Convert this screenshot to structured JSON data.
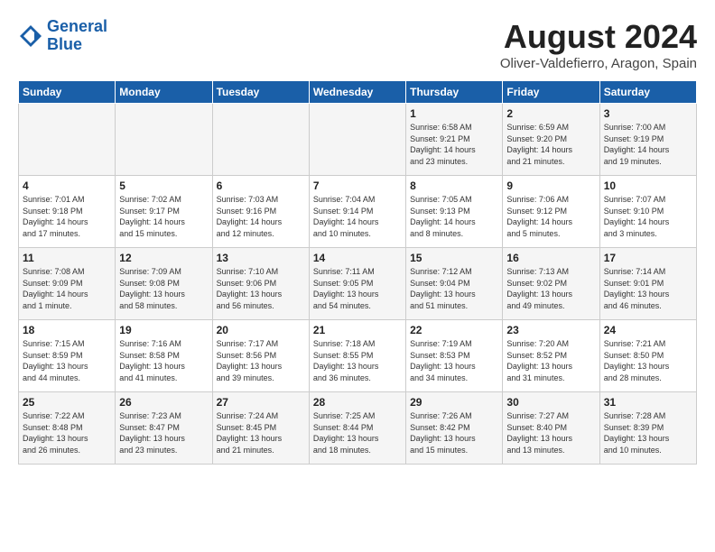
{
  "header": {
    "logo_line1": "General",
    "logo_line2": "Blue",
    "title": "August 2024",
    "subtitle": "Oliver-Valdefierro, Aragon, Spain"
  },
  "weekdays": [
    "Sunday",
    "Monday",
    "Tuesday",
    "Wednesday",
    "Thursday",
    "Friday",
    "Saturday"
  ],
  "weeks": [
    [
      {
        "day": "",
        "empty": true
      },
      {
        "day": "",
        "empty": true
      },
      {
        "day": "",
        "empty": true
      },
      {
        "day": "",
        "empty": true
      },
      {
        "day": "1",
        "lines": [
          "Sunrise: 6:58 AM",
          "Sunset: 9:21 PM",
          "Daylight: 14 hours",
          "and 23 minutes."
        ]
      },
      {
        "day": "2",
        "lines": [
          "Sunrise: 6:59 AM",
          "Sunset: 9:20 PM",
          "Daylight: 14 hours",
          "and 21 minutes."
        ]
      },
      {
        "day": "3",
        "lines": [
          "Sunrise: 7:00 AM",
          "Sunset: 9:19 PM",
          "Daylight: 14 hours",
          "and 19 minutes."
        ]
      }
    ],
    [
      {
        "day": "4",
        "lines": [
          "Sunrise: 7:01 AM",
          "Sunset: 9:18 PM",
          "Daylight: 14 hours",
          "and 17 minutes."
        ]
      },
      {
        "day": "5",
        "lines": [
          "Sunrise: 7:02 AM",
          "Sunset: 9:17 PM",
          "Daylight: 14 hours",
          "and 15 minutes."
        ]
      },
      {
        "day": "6",
        "lines": [
          "Sunrise: 7:03 AM",
          "Sunset: 9:16 PM",
          "Daylight: 14 hours",
          "and 12 minutes."
        ]
      },
      {
        "day": "7",
        "lines": [
          "Sunrise: 7:04 AM",
          "Sunset: 9:14 PM",
          "Daylight: 14 hours",
          "and 10 minutes."
        ]
      },
      {
        "day": "8",
        "lines": [
          "Sunrise: 7:05 AM",
          "Sunset: 9:13 PM",
          "Daylight: 14 hours",
          "and 8 minutes."
        ]
      },
      {
        "day": "9",
        "lines": [
          "Sunrise: 7:06 AM",
          "Sunset: 9:12 PM",
          "Daylight: 14 hours",
          "and 5 minutes."
        ]
      },
      {
        "day": "10",
        "lines": [
          "Sunrise: 7:07 AM",
          "Sunset: 9:10 PM",
          "Daylight: 14 hours",
          "and 3 minutes."
        ]
      }
    ],
    [
      {
        "day": "11",
        "lines": [
          "Sunrise: 7:08 AM",
          "Sunset: 9:09 PM",
          "Daylight: 14 hours",
          "and 1 minute."
        ]
      },
      {
        "day": "12",
        "lines": [
          "Sunrise: 7:09 AM",
          "Sunset: 9:08 PM",
          "Daylight: 13 hours",
          "and 58 minutes."
        ]
      },
      {
        "day": "13",
        "lines": [
          "Sunrise: 7:10 AM",
          "Sunset: 9:06 PM",
          "Daylight: 13 hours",
          "and 56 minutes."
        ]
      },
      {
        "day": "14",
        "lines": [
          "Sunrise: 7:11 AM",
          "Sunset: 9:05 PM",
          "Daylight: 13 hours",
          "and 54 minutes."
        ]
      },
      {
        "day": "15",
        "lines": [
          "Sunrise: 7:12 AM",
          "Sunset: 9:04 PM",
          "Daylight: 13 hours",
          "and 51 minutes."
        ]
      },
      {
        "day": "16",
        "lines": [
          "Sunrise: 7:13 AM",
          "Sunset: 9:02 PM",
          "Daylight: 13 hours",
          "and 49 minutes."
        ]
      },
      {
        "day": "17",
        "lines": [
          "Sunrise: 7:14 AM",
          "Sunset: 9:01 PM",
          "Daylight: 13 hours",
          "and 46 minutes."
        ]
      }
    ],
    [
      {
        "day": "18",
        "lines": [
          "Sunrise: 7:15 AM",
          "Sunset: 8:59 PM",
          "Daylight: 13 hours",
          "and 44 minutes."
        ]
      },
      {
        "day": "19",
        "lines": [
          "Sunrise: 7:16 AM",
          "Sunset: 8:58 PM",
          "Daylight: 13 hours",
          "and 41 minutes."
        ]
      },
      {
        "day": "20",
        "lines": [
          "Sunrise: 7:17 AM",
          "Sunset: 8:56 PM",
          "Daylight: 13 hours",
          "and 39 minutes."
        ]
      },
      {
        "day": "21",
        "lines": [
          "Sunrise: 7:18 AM",
          "Sunset: 8:55 PM",
          "Daylight: 13 hours",
          "and 36 minutes."
        ]
      },
      {
        "day": "22",
        "lines": [
          "Sunrise: 7:19 AM",
          "Sunset: 8:53 PM",
          "Daylight: 13 hours",
          "and 34 minutes."
        ]
      },
      {
        "day": "23",
        "lines": [
          "Sunrise: 7:20 AM",
          "Sunset: 8:52 PM",
          "Daylight: 13 hours",
          "and 31 minutes."
        ]
      },
      {
        "day": "24",
        "lines": [
          "Sunrise: 7:21 AM",
          "Sunset: 8:50 PM",
          "Daylight: 13 hours",
          "and 28 minutes."
        ]
      }
    ],
    [
      {
        "day": "25",
        "lines": [
          "Sunrise: 7:22 AM",
          "Sunset: 8:48 PM",
          "Daylight: 13 hours",
          "and 26 minutes."
        ]
      },
      {
        "day": "26",
        "lines": [
          "Sunrise: 7:23 AM",
          "Sunset: 8:47 PM",
          "Daylight: 13 hours",
          "and 23 minutes."
        ]
      },
      {
        "day": "27",
        "lines": [
          "Sunrise: 7:24 AM",
          "Sunset: 8:45 PM",
          "Daylight: 13 hours",
          "and 21 minutes."
        ]
      },
      {
        "day": "28",
        "lines": [
          "Sunrise: 7:25 AM",
          "Sunset: 8:44 PM",
          "Daylight: 13 hours",
          "and 18 minutes."
        ]
      },
      {
        "day": "29",
        "lines": [
          "Sunrise: 7:26 AM",
          "Sunset: 8:42 PM",
          "Daylight: 13 hours",
          "and 15 minutes."
        ]
      },
      {
        "day": "30",
        "lines": [
          "Sunrise: 7:27 AM",
          "Sunset: 8:40 PM",
          "Daylight: 13 hours",
          "and 13 minutes."
        ]
      },
      {
        "day": "31",
        "lines": [
          "Sunrise: 7:28 AM",
          "Sunset: 8:39 PM",
          "Daylight: 13 hours",
          "and 10 minutes."
        ]
      }
    ]
  ]
}
